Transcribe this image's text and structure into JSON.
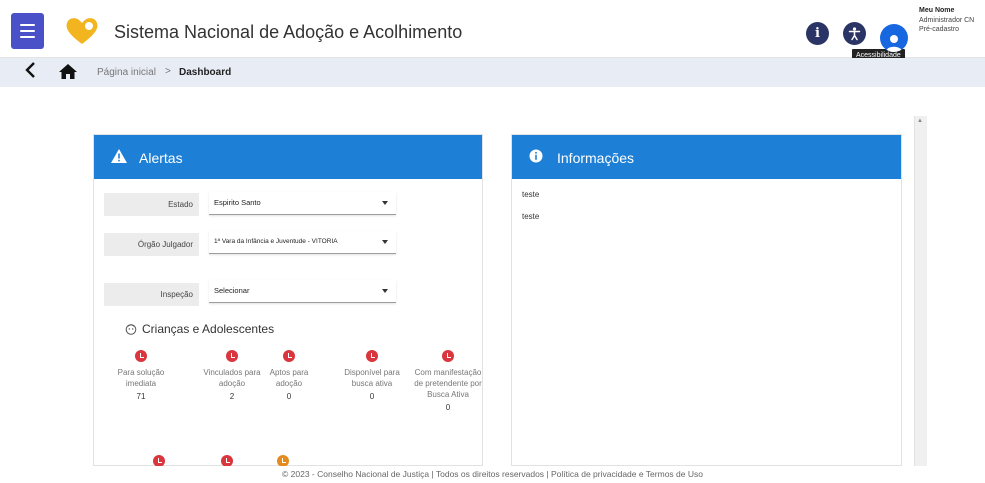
{
  "header": {
    "app_title": "Sistema Nacional de Adoção e Acolhimento",
    "info_icon_glyph": "i",
    "accessibility_tooltip": "Acessibilidade",
    "user": {
      "name": "Meu Nome",
      "role": "Administrador CN",
      "status": "Pré-cadastro"
    }
  },
  "breadcrumb": {
    "home": "Página inicial",
    "separator": ">",
    "current": "Dashboard"
  },
  "alerts_panel": {
    "title": "Alertas",
    "filters": [
      {
        "label": "Estado",
        "value": "Espirito Santo"
      },
      {
        "label": "Órgão Julgador",
        "value": "1ª Vara da Infância e Juventude - VITORIA"
      },
      {
        "label": "Inspeção",
        "value": "Selecionar"
      }
    ],
    "section_title": "Crianças e Adolescentes",
    "metrics": [
      {
        "label": "Para solução imediata",
        "value": "71",
        "color": "#d9363e"
      },
      {
        "label": "Vinculados para adoção",
        "value": "2",
        "color": "#d9363e"
      },
      {
        "label": "Aptos para adoção",
        "value": "0",
        "color": "#d9363e"
      },
      {
        "label": "Disponível para busca ativa",
        "value": "0",
        "color": "#d9363e"
      },
      {
        "label": "Com manifestação de pretendente por Busca Ativa",
        "value": "0",
        "color": "#d9363e"
      }
    ],
    "metrics_row2_colors": [
      "#d9363e",
      "#d9363e",
      "#e58a1c"
    ]
  },
  "info_panel": {
    "title": "Informações",
    "lines": [
      "teste",
      "teste"
    ]
  },
  "footer": {
    "text": "© 2023 - Conselho Nacional de Justiça | Todos os direitos reservados | Política de privacidade e Termos de Uso"
  },
  "colors": {
    "menu_button": "#4a50c8",
    "panel_header": "#1e7fd6",
    "breadcrumb_bar": "#e7ecf5",
    "logo": "#f2b51f"
  }
}
